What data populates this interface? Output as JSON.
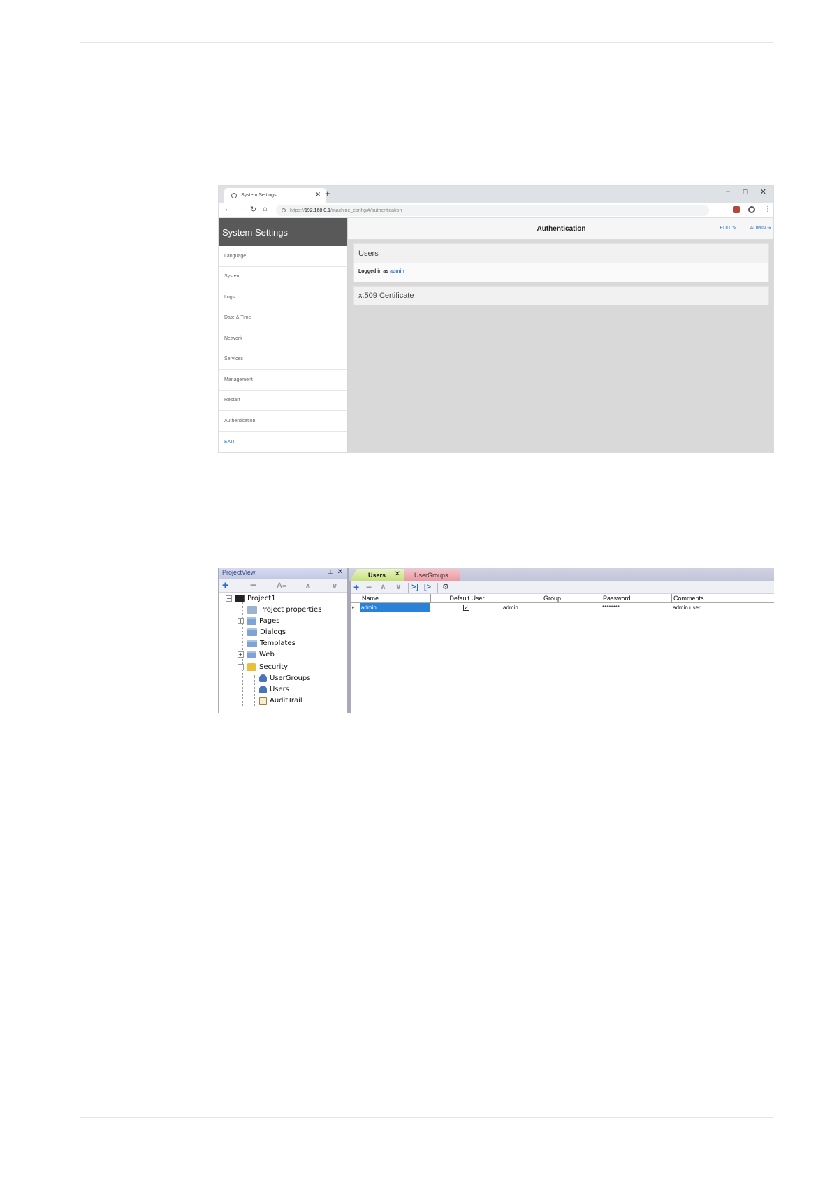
{
  "browser": {
    "tab_title": "System Settings",
    "new_tab_glyph": "+",
    "url_scheme": "https://",
    "url_host": "192.168.0.1",
    "url_path": "/machine_config/#/authentication",
    "icons": [
      "globe-icon",
      "back-icon",
      "forward-icon",
      "reload-icon",
      "home-icon",
      "lock-icon",
      "pdf-extension-icon",
      "account-icon",
      "menu-icon"
    ]
  },
  "app": {
    "brand": "System Settings",
    "sidebar_items": [
      "Language",
      "System",
      "Logs",
      "Date & Time",
      "Network",
      "Services",
      "Management",
      "Restart",
      "Authentication"
    ],
    "exit_label": "EXIT",
    "header_title": "Authentication",
    "edit_label": "EDIT",
    "admin_label": "ADMIN",
    "users_panel_title": "Users",
    "logged_in_prefix": "Logged in as",
    "logged_in_user": "admin",
    "cert_panel_title": "x.509 Certificate",
    "colors": {
      "brand_bar": "#595959",
      "accent": "#3a7dc9",
      "content_bg": "#d9d9d9"
    }
  },
  "ide": {
    "projectview_title": "ProjectView",
    "tree": {
      "root": "Project1",
      "project_properties": "Project properties",
      "pages": "Pages",
      "dialogs": "Dialogs",
      "templates": "Templates",
      "web": "Web",
      "security": "Security",
      "usergroups": "UserGroups",
      "users": "Users",
      "audittrail": "AuditTrail"
    },
    "tabs": {
      "users": "Users",
      "usergroups": "UserGroups"
    },
    "columns": [
      "Name",
      "Default User",
      "Group",
      "Password",
      "Comments"
    ],
    "rows": [
      {
        "name": "admin",
        "default_user": true,
        "group": "admin",
        "password": "********",
        "comments": "admin user"
      }
    ],
    "colors": {
      "selected_cell": "#2a82d8",
      "active_tab": "#c6e07a",
      "inactive_tab": "#e99aa3"
    }
  }
}
